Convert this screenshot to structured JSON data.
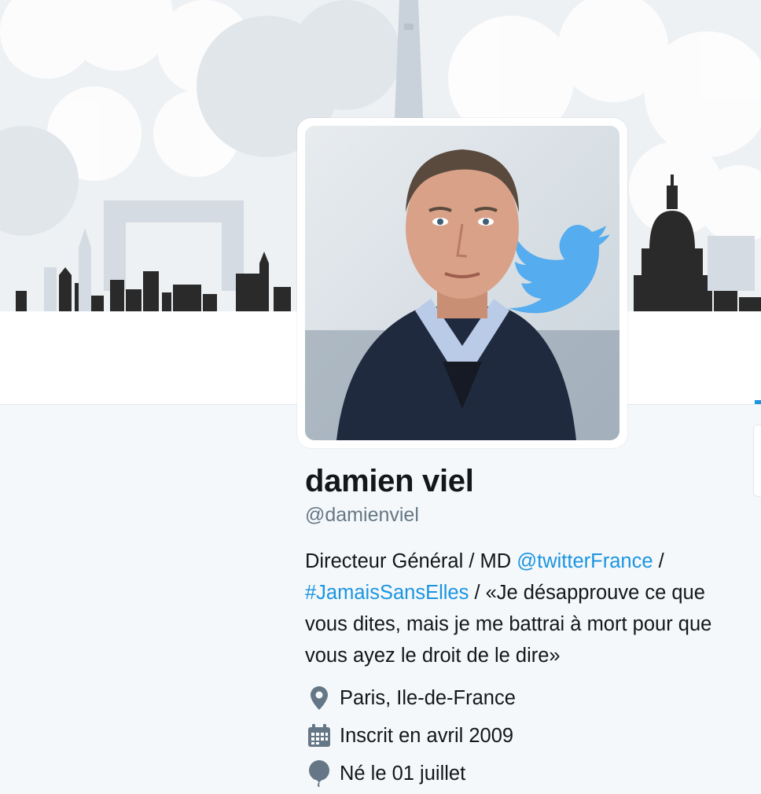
{
  "profile": {
    "name": "damien viel",
    "handle": "@damienviel",
    "bio": {
      "part1": "Directeur Général / MD ",
      "mention": "@twitterFrance",
      "part2": " / ",
      "hashtag": "#JamaisSansElles",
      "part3": " / «Je désapprouve ce que vous dites, mais je me battrai à mort pour que vous ayez le droit de le dire»"
    },
    "location": "Paris, Ile-de-France",
    "joined": "Inscrit en avril 2009",
    "birthday": "Né le 01 juillet"
  },
  "icons": {
    "location": "map-pin-icon",
    "joined": "calendar-icon",
    "birthday": "balloon-icon"
  },
  "colors": {
    "link": "#1b95e0",
    "text": "#14171a",
    "secondary": "#657786",
    "background": "#f5f8fa"
  }
}
